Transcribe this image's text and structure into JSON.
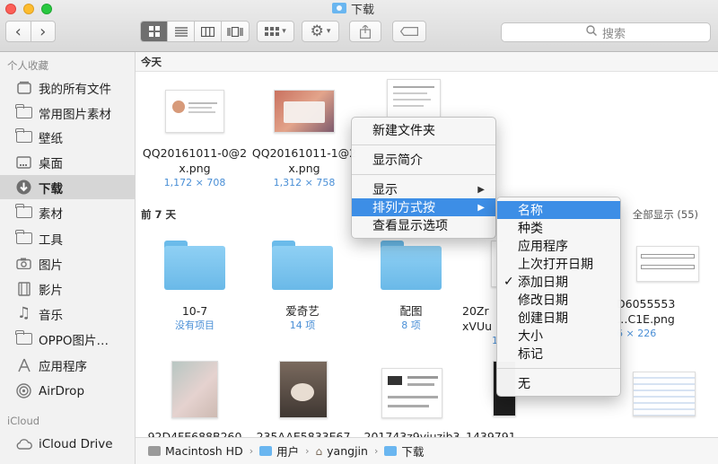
{
  "window": {
    "title": "下载"
  },
  "toolbar": {
    "back_glyph": "‹",
    "forward_glyph": "›",
    "view_icons": [
      "icon-view-icon",
      "list-view-icon",
      "column-view-icon",
      "coverflow-view-icon"
    ],
    "search_placeholder": "搜索"
  },
  "sidebar": {
    "favorites_heading": "个人收藏",
    "icloud_heading": "iCloud",
    "items": [
      {
        "label": "我的所有文件",
        "icon": "all-files-icon"
      },
      {
        "label": "常用图片素材",
        "icon": "folder-icon"
      },
      {
        "label": "壁纸",
        "icon": "folder-icon"
      },
      {
        "label": "桌面",
        "icon": "desktop-icon"
      },
      {
        "label": "下载",
        "icon": "download-icon",
        "selected": true
      },
      {
        "label": "素材",
        "icon": "folder-icon"
      },
      {
        "label": "工具",
        "icon": "folder-icon"
      },
      {
        "label": "图片",
        "icon": "camera-icon"
      },
      {
        "label": "影片",
        "icon": "film-icon"
      },
      {
        "label": "音乐",
        "icon": "music-icon"
      },
      {
        "label": "OPPO图片…",
        "icon": "folder-icon"
      },
      {
        "label": "应用程序",
        "icon": "applications-icon"
      },
      {
        "label": "AirDrop",
        "icon": "airdrop-icon"
      }
    ],
    "icloud_items": [
      {
        "label": "iCloud Drive",
        "icon": "cloud-icon"
      }
    ]
  },
  "sections": {
    "today": {
      "title": "今天"
    },
    "last7": {
      "title": "前 7 天",
      "count_label": "全部显示 (55)"
    }
  },
  "files_today": [
    {
      "name_line1": "QQ20161011-0@2",
      "name_line2": "x.png",
      "sub": "1,172 × 708"
    },
    {
      "name_line1": "QQ20161011-1@2",
      "name_line2": "x.png",
      "sub": "1,312 × 758"
    }
  ],
  "files_week": [
    {
      "name": "10-7",
      "sub": "没有项目"
    },
    {
      "name": "爱奇艺",
      "sub": "14 项"
    },
    {
      "name": "配图",
      "sub": "8 项"
    },
    {
      "name": "20Zr",
      "name2": "xVUu",
      "sub": "1"
    },
    {
      "name": "D6055553",
      "name2": "…C1E.png",
      "sub": "6 × 226"
    }
  ],
  "files_row3": [
    {
      "name": "92D4FE688B260"
    },
    {
      "name": "235AAE5833E67"
    },
    {
      "name": "201743z9yjuzib3"
    },
    {
      "name": "1439791"
    }
  ],
  "context_menu": {
    "new_folder": "新建文件夹",
    "get_info": "显示简介",
    "show": "显示",
    "sort_by": "排列方式按",
    "view_options": "查看显示选项"
  },
  "sort_submenu": {
    "items": [
      "名称",
      "种类",
      "应用程序",
      "上次打开日期",
      "添加日期",
      "修改日期",
      "创建日期",
      "大小",
      "标记"
    ],
    "checked": "添加日期",
    "none": "无",
    "check_glyph": "✓"
  },
  "pathbar": {
    "segments": [
      "Macintosh HD",
      "用户",
      "yangjin",
      "下载"
    ],
    "separator": "›"
  },
  "colors": {
    "highlight": "#3d8ee6",
    "folder": "#6ab9e8",
    "subtext": "#4a8fd6"
  }
}
